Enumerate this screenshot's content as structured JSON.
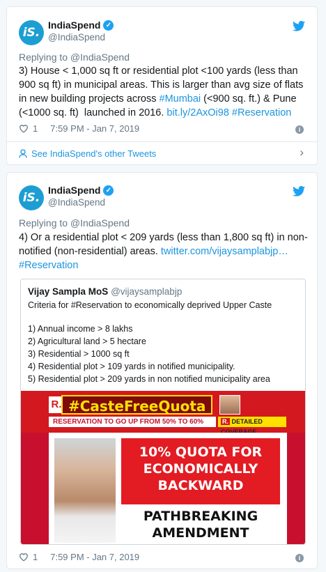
{
  "tweets": [
    {
      "author": "IndiaSpend",
      "handle": "@IndiaSpend",
      "avatar_text": "iS.",
      "replying": "Replying to @IndiaSpend",
      "text_lines": [
        "3) House < 1,000 sq ft or residential plot <100 yards (less than",
        "900 sq ft) in municipal areas. This is larger than avg size of flats",
        "in new building projects across",
        "#Mumbai",
        " (<900 sq. ft.) & Pune",
        "(<1000 sq. ft)  launched in 2016. ",
        "bit.ly/2AxOi98",
        "#Reservation"
      ],
      "likes": "1",
      "timestamp": "7:59 PM - Jan 7, 2019",
      "see_more": "See IndiaSpend's other Tweets"
    },
    {
      "author": "IndiaSpend",
      "handle": "@IndiaSpend",
      "avatar_text": "iS.",
      "replying": "Replying to @IndiaSpend",
      "text_lines": [
        "4) Or a residential plot < 209 yards (less than 1,800 sq ft) in non-",
        "notified (non-residential) areas. ",
        "twitter.com/vijaysamplabjp…",
        "#Reservation"
      ],
      "likes": "1",
      "timestamp": "7:59 PM - Jan 7, 2019",
      "quote": {
        "author": "Vijay Sampla MoS",
        "handle": "@vijaysamplabjp",
        "lines": [
          "Criteria for #Reservation to economically deprived Upper Caste",
          "1) Annual income > 8 lakhs",
          "2) Agricultural land > 5 hectare",
          "3) Residential > 1000 sq ft",
          "4) Residential plot > 109 yards in notified municipality.",
          "5) Residential plot > 209 yards in non notified municipality area"
        ],
        "image": {
          "r_logo": "R.",
          "hashtag": "#CasteFreeQuota",
          "ticker": "RESERVATION TO GO UP FROM 50% TO 60%",
          "ticker_logo": "R.",
          "ticker_tag": "DETAILED COVERAGE",
          "headline": "10% QUOTA FOR ECONOMICALLY BACKWARD",
          "subheadline": "PATHBREAKING AMENDMENT"
        }
      }
    }
  ],
  "icons": {
    "verified": "check",
    "bird": "twitter-bird-icon",
    "heart": "heart-icon",
    "info": "info-icon",
    "person": "person-icon",
    "chevron": "chevron-right-icon"
  },
  "colors": {
    "link": "#1b95e0",
    "brand": "#1da1f2"
  }
}
